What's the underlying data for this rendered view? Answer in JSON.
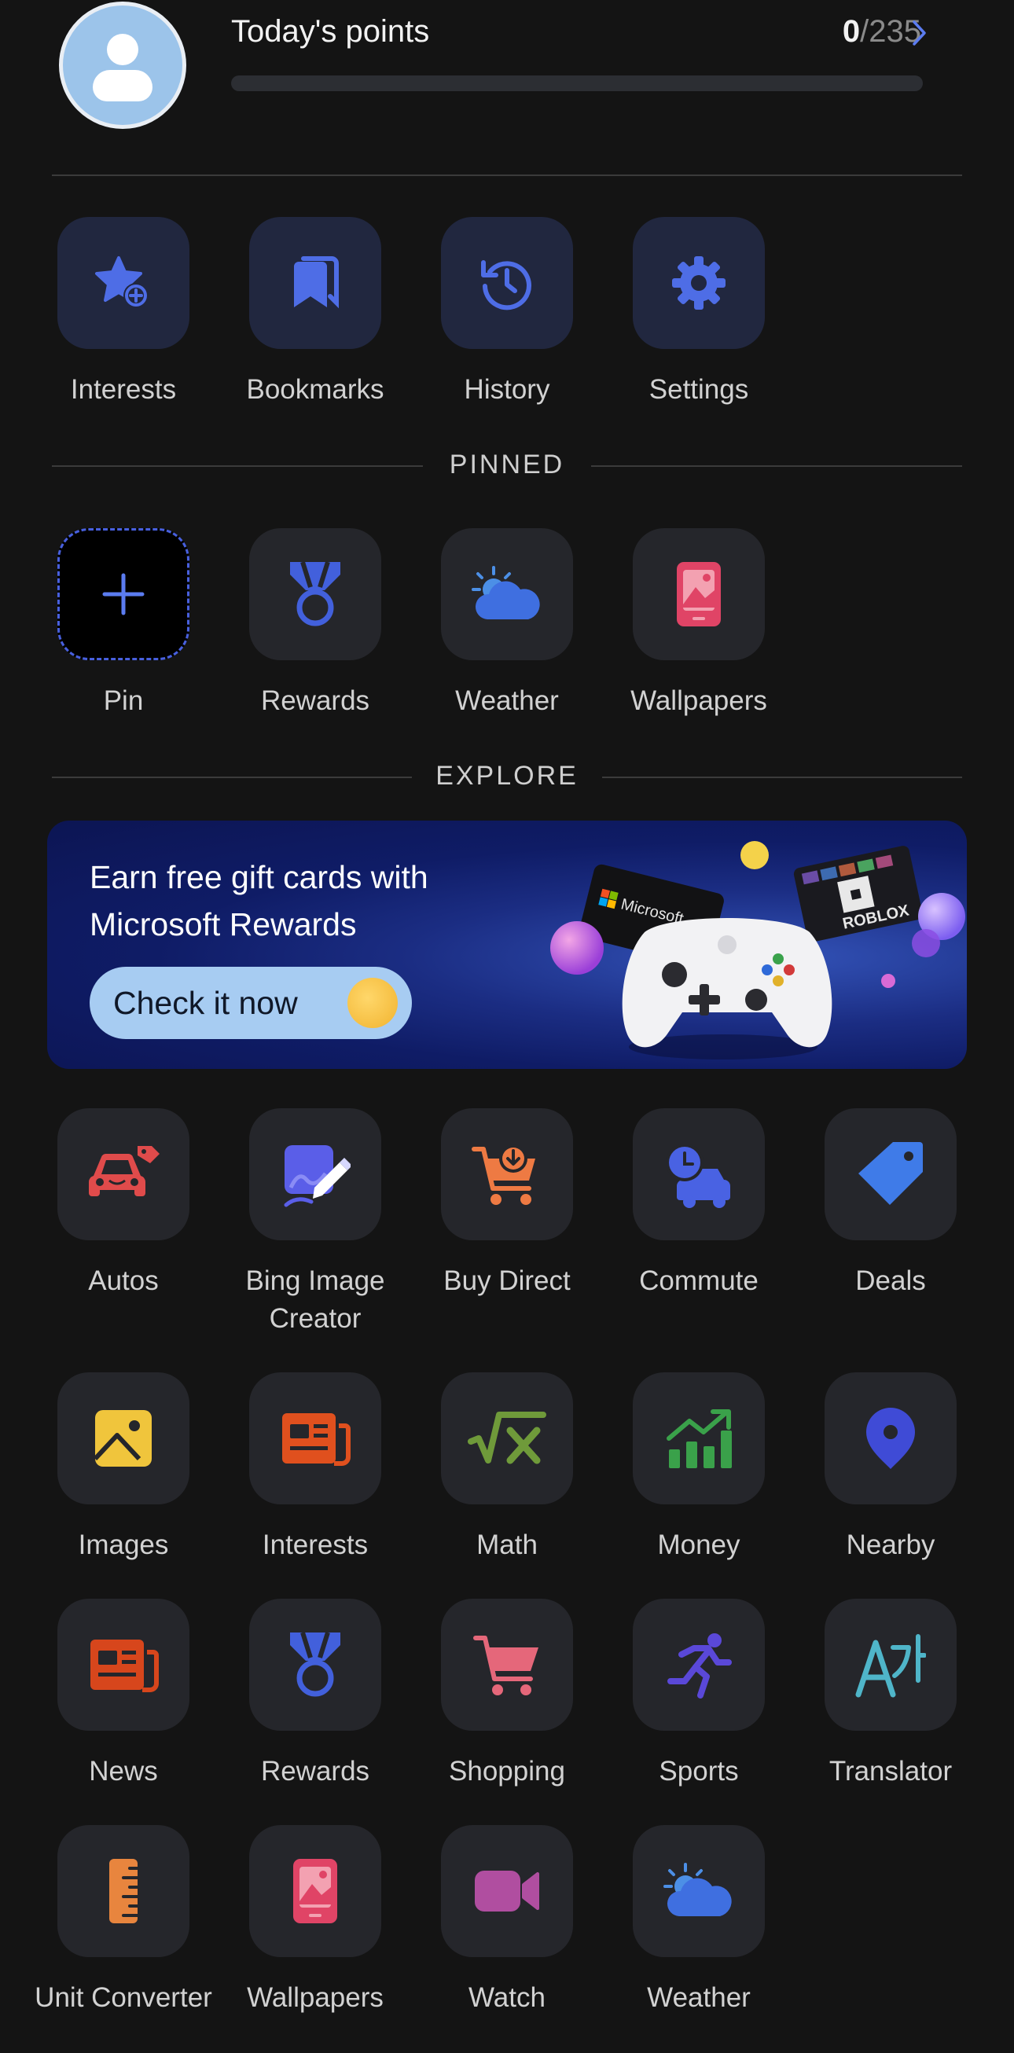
{
  "header": {
    "title": "Today's points",
    "points_current": "0",
    "points_total": "/235",
    "progress": 0
  },
  "quick_actions": [
    {
      "label": "Interests",
      "icon": "star-plus-icon"
    },
    {
      "label": "Bookmarks",
      "icon": "bookmarks-icon"
    },
    {
      "label": "History",
      "icon": "history-icon"
    },
    {
      "label": "Settings",
      "icon": "gear-icon"
    }
  ],
  "pinned": {
    "heading": "PINNED",
    "items": [
      {
        "label": "Pin",
        "icon": "plus-icon"
      },
      {
        "label": "Rewards",
        "icon": "medal-icon"
      },
      {
        "label": "Weather",
        "icon": "weather-icon"
      },
      {
        "label": "Wallpapers",
        "icon": "wallpaper-icon"
      }
    ]
  },
  "explore": {
    "heading": "EXPLORE",
    "banner": {
      "title": "Earn free gift cards with Microsoft Rewards",
      "button": "Check it now",
      "card_brand": "Microsoft",
      "card_brand_2": "ROBLOX"
    },
    "items": [
      {
        "label": "Autos",
        "icon": "car-icon"
      },
      {
        "label": "Bing Image Creator",
        "icon": "image-creator-icon"
      },
      {
        "label": "Buy Direct",
        "icon": "cart-download-icon"
      },
      {
        "label": "Commute",
        "icon": "commute-icon"
      },
      {
        "label": "Deals",
        "icon": "tag-icon"
      },
      {
        "label": "Images",
        "icon": "picture-icon"
      },
      {
        "label": "Interests",
        "icon": "newspaper-icon"
      },
      {
        "label": "Math",
        "icon": "square-root-icon"
      },
      {
        "label": "Money",
        "icon": "chart-up-icon"
      },
      {
        "label": "Nearby",
        "icon": "location-pin-icon"
      },
      {
        "label": "News",
        "icon": "news-icon"
      },
      {
        "label": "Rewards",
        "icon": "medal-icon"
      },
      {
        "label": "Shopping",
        "icon": "shopping-cart-icon"
      },
      {
        "label": "Sports",
        "icon": "running-icon"
      },
      {
        "label": "Translator",
        "icon": "translator-icon"
      },
      {
        "label": "Unit Converter",
        "icon": "ruler-icon"
      },
      {
        "label": "Wallpapers",
        "icon": "wallpaper-icon"
      },
      {
        "label": "Watch",
        "icon": "video-camera-icon"
      },
      {
        "label": "Weather",
        "icon": "weather-icon"
      }
    ]
  },
  "colors": {
    "background": "#141414",
    "tile": "#25262b",
    "accent": "#4b6be8"
  }
}
